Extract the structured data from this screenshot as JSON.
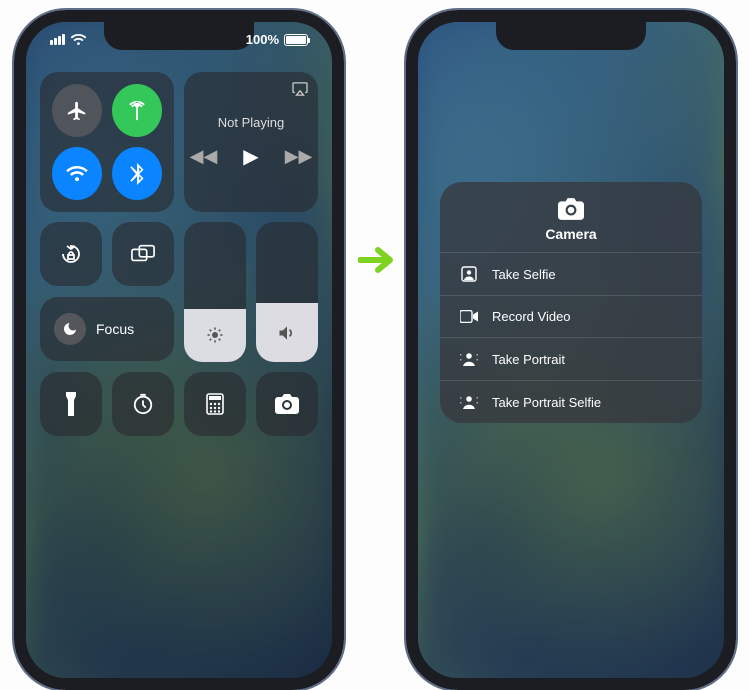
{
  "status": {
    "battery_pct": "100%"
  },
  "control_center": {
    "media_status": "Not Playing",
    "focus_label": "Focus"
  },
  "camera_menu": {
    "title": "Camera",
    "items": [
      {
        "label": "Take Selfie"
      },
      {
        "label": "Record Video"
      },
      {
        "label": "Take Portrait"
      },
      {
        "label": "Take Portrait Selfie"
      }
    ]
  }
}
